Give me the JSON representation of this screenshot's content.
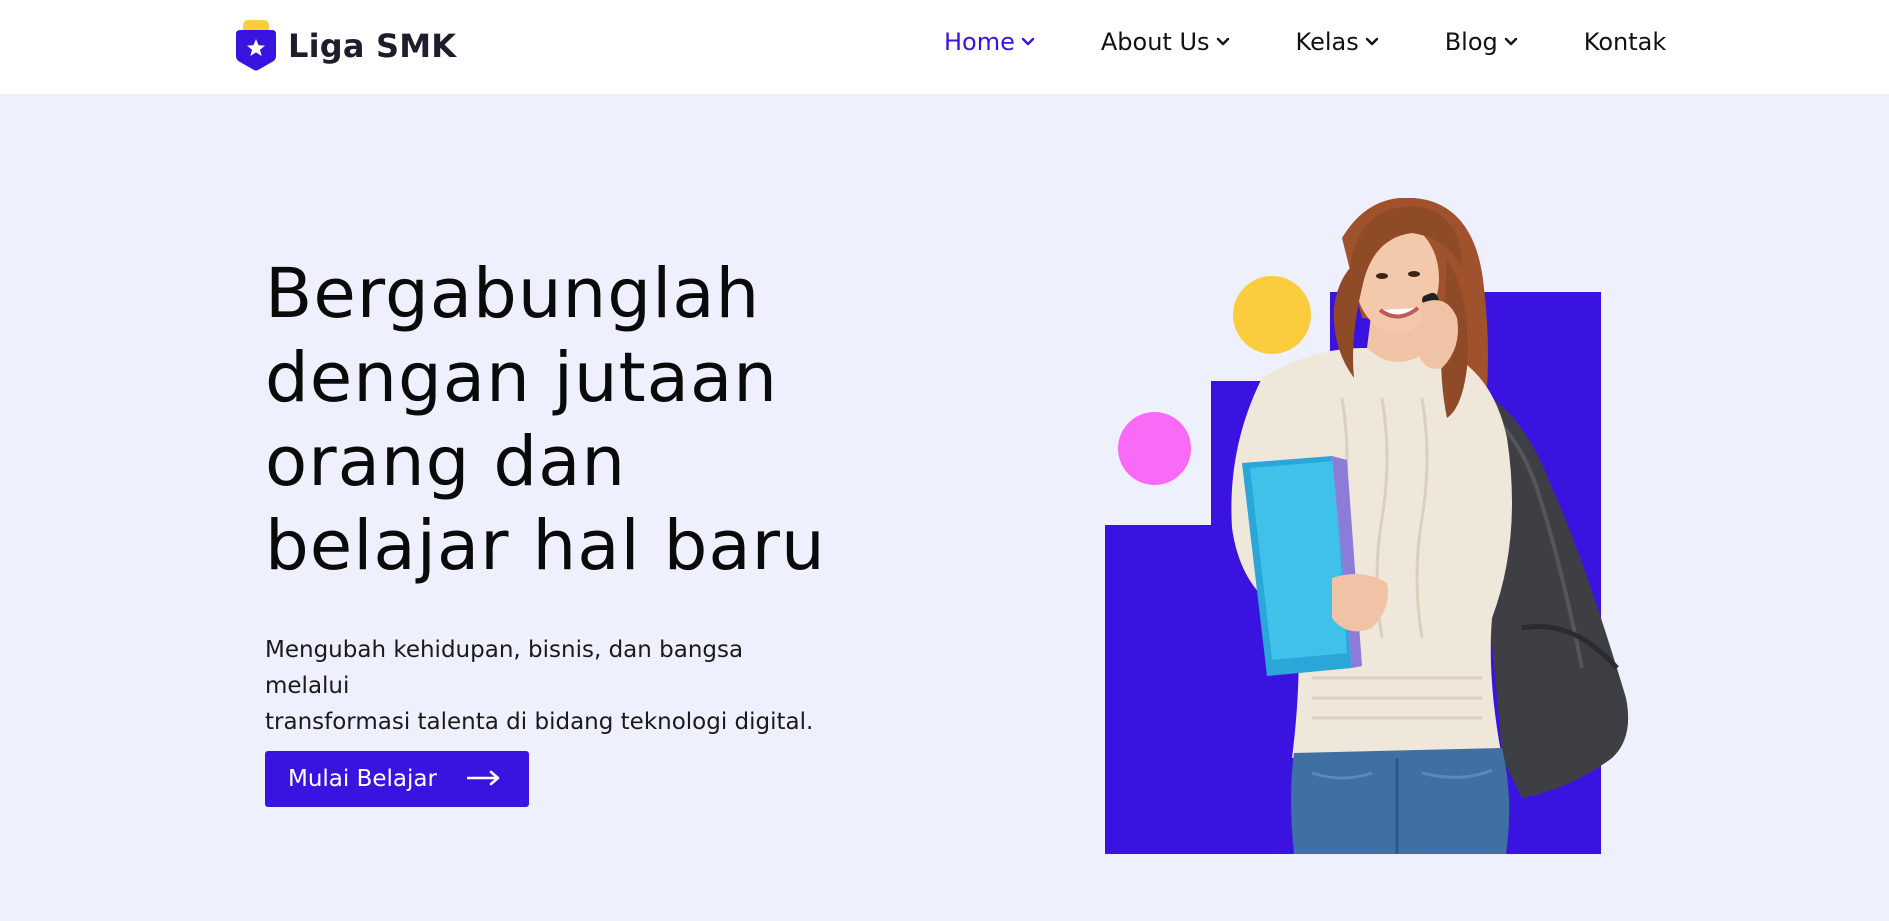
{
  "brand": {
    "name": "Liga SMK",
    "logo_icon": "star-shield-icon",
    "colors": {
      "primary": "#3b13e0",
      "accent_yellow": "#fbcd3e",
      "accent_pink": "#f96af7",
      "background": "#eef0fd"
    }
  },
  "nav": {
    "items": [
      {
        "label": "Home",
        "has_dropdown": true,
        "active": true
      },
      {
        "label": "About Us",
        "has_dropdown": true,
        "active": false
      },
      {
        "label": "Kelas",
        "has_dropdown": true,
        "active": false
      },
      {
        "label": "Blog",
        "has_dropdown": true,
        "active": false
      },
      {
        "label": "Kontak",
        "has_dropdown": false,
        "active": false
      }
    ]
  },
  "hero": {
    "title_lines": [
      "Bergabunglah",
      "dengan jutaan",
      "orang dan",
      "belajar hal baru"
    ],
    "subtitle_lines": [
      "Mengubah kehidupan, bisnis, dan bangsa melalui",
      "transformasi talenta di bidang teknologi digital."
    ],
    "cta_label": "Mulai Belajar",
    "cta_icon": "arrow-right-icon"
  },
  "illustration": {
    "subject": "student-photo",
    "decor": [
      "yellow-circle",
      "pink-circle",
      "blue-block"
    ]
  }
}
